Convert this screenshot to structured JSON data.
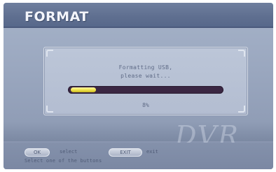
{
  "screen": {
    "title": "FORMAT"
  },
  "dialog": {
    "message_line1": "Formatting USB,",
    "message_line2": "please wait...",
    "progress_percent": 8,
    "percent_text": "8%"
  },
  "watermark": "DVR",
  "footer": {
    "ok_key": "OK",
    "ok_action": "select",
    "exit_key": "EXIT",
    "exit_action": "exit",
    "hint": "Select one of the buttons"
  },
  "colors": {
    "progress_fill": "#efe24a",
    "progress_track": "#3b2743",
    "title_bar": "#5f6f90"
  }
}
